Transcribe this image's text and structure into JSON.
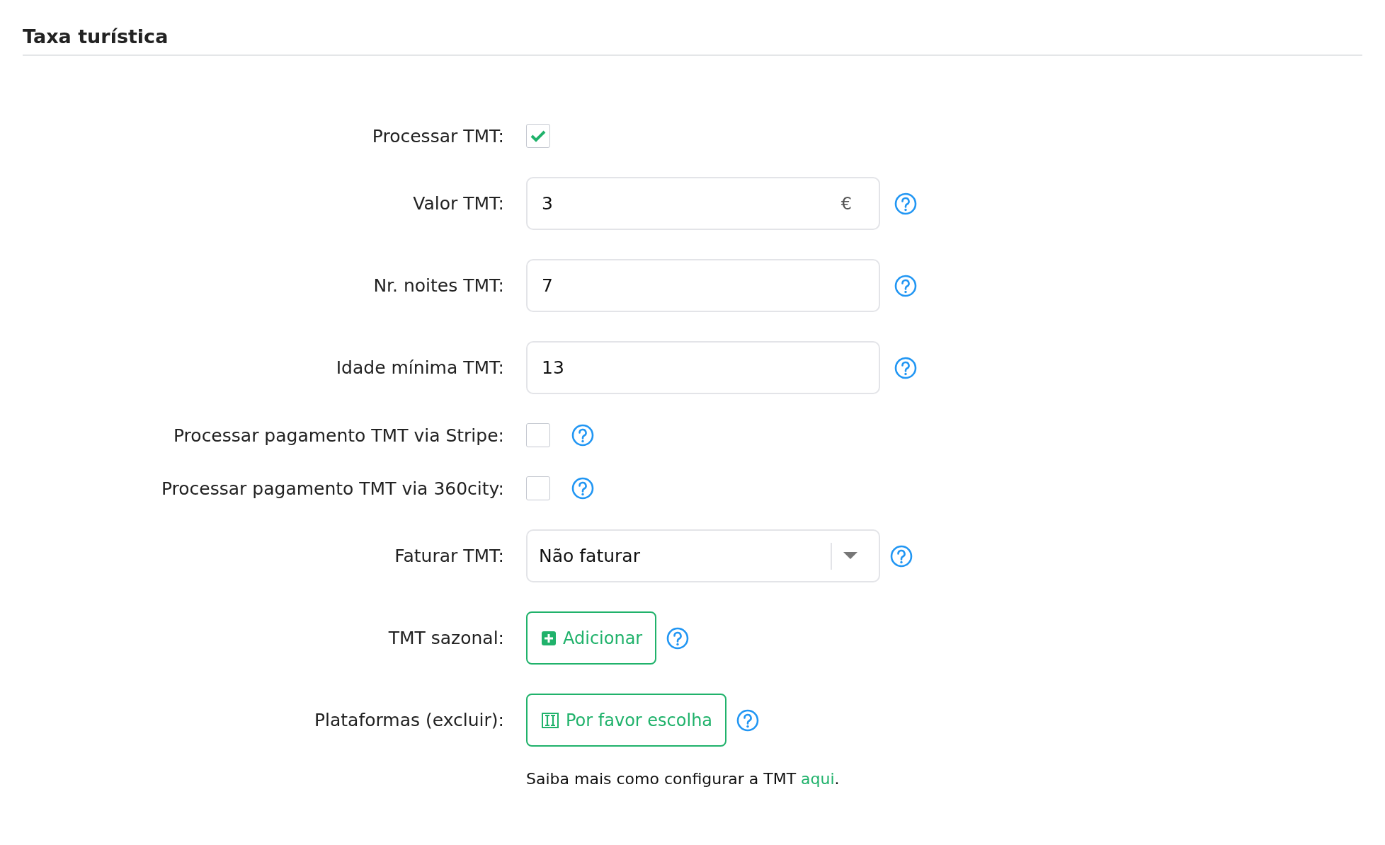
{
  "section": {
    "title": "Taxa turística"
  },
  "rows": [
    {
      "kind": "checkbox",
      "label": "Processar TMT:",
      "checked": true,
      "help": false
    },
    {
      "kind": "input",
      "label": "Valor TMT:",
      "value": "3",
      "suffix": "€",
      "help": true
    },
    {
      "kind": "input",
      "label": "Nr. noites TMT:",
      "value": "7",
      "help": true
    },
    {
      "kind": "input",
      "label": "Idade mínima TMT:",
      "value": "13",
      "help": true
    },
    {
      "kind": "checkbox",
      "label": "Processar pagamento TMT via Stripe:",
      "checked": false,
      "help": true
    },
    {
      "kind": "checkbox",
      "label": "Processar pagamento TMT via 360city:",
      "checked": false,
      "help": true
    },
    {
      "kind": "select",
      "label": "Faturar TMT:",
      "value": "Não faturar",
      "help": true
    },
    {
      "kind": "add_button",
      "label": "TMT sazonal:",
      "button": "Adicionar",
      "help": true
    },
    {
      "kind": "pick_button",
      "label": "Plataformas (excluir):",
      "button": "Por favor escolha",
      "help": true
    }
  ],
  "footer": {
    "text": "Saiba mais como configurar a TMT ",
    "link": "aqui",
    "after": "."
  }
}
